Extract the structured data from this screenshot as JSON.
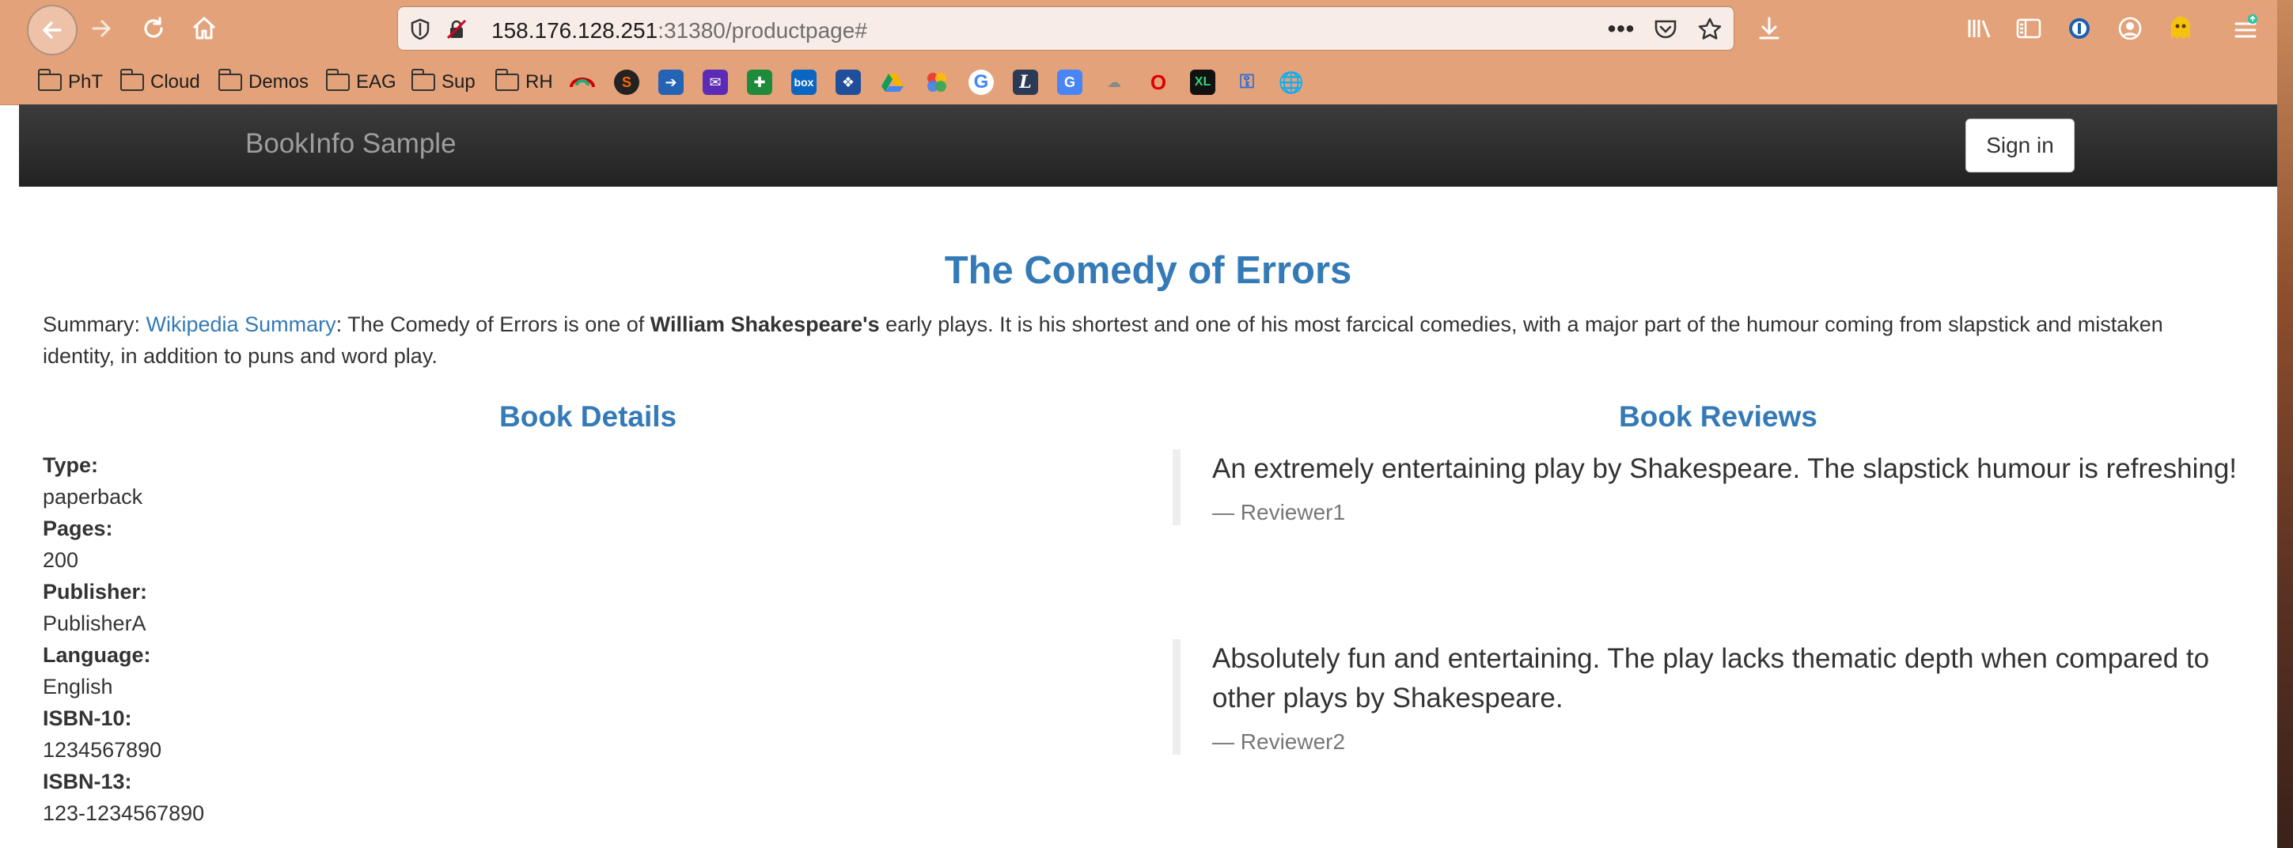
{
  "browser": {
    "url_host": "158.176.128.251",
    "url_rest": ":31380/productpage#",
    "bookmarks": {
      "folders": [
        "PhT",
        "Cloud",
        "Demos",
        "EAG",
        "Sup",
        "RH"
      ]
    }
  },
  "navbar": {
    "brand": "BookInfo Sample",
    "signin_label": "Sign in"
  },
  "book": {
    "title": "The Comedy of Errors",
    "summary_prefix": "Summary: ",
    "summary_link": "Wikipedia Summary",
    "summary_before_bold": ": The Comedy of Errors is one of ",
    "summary_bold": "William Shakespeare's",
    "summary_after_bold": " early plays. It is his shortest and one of his most farcical comedies, with a major part of the humour coming from slapstick and mistaken identity, in addition to puns and word play."
  },
  "details": {
    "heading": "Book Details",
    "fields": [
      {
        "label": "Type:",
        "value": "paperback"
      },
      {
        "label": "Pages:",
        "value": "200"
      },
      {
        "label": "Publisher:",
        "value": "PublisherA"
      },
      {
        "label": "Language:",
        "value": "English"
      },
      {
        "label": "ISBN-10:",
        "value": "1234567890"
      },
      {
        "label": "ISBN-13:",
        "value": "123-1234567890"
      }
    ]
  },
  "reviews": {
    "heading": "Book Reviews",
    "items": [
      {
        "text": "An extremely entertaining play by Shakespeare. The slapstick humour is refreshing!",
        "author": "— Reviewer1"
      },
      {
        "text": "Absolutely fun and entertaining. The play lacks thematic depth when compared to other plays by Shakespeare.",
        "author": "— Reviewer2"
      }
    ]
  },
  "colors": {
    "link_blue": "#337ab7",
    "navbar_dark": "#222222",
    "browser_chrome": "#e3a27a"
  }
}
